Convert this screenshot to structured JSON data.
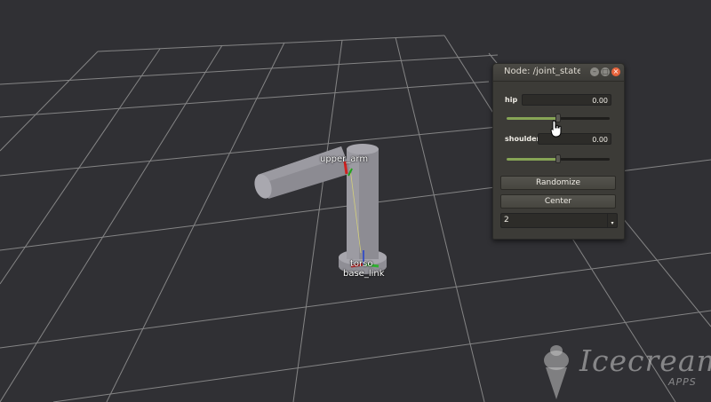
{
  "scene": {
    "background_color": "#303034",
    "grid_color": "#9a9a9a",
    "labels": {
      "upper_arm": "upper_arm",
      "torso": "torso",
      "base_link": "base_link"
    }
  },
  "jsp_window": {
    "title": "Node: /joint_state_publisher",
    "buttons": {
      "minimize": "–",
      "maximize": "□",
      "close": "×"
    },
    "joints": [
      {
        "name": "hip",
        "value": "0.00",
        "position": 0.5
      },
      {
        "name": "shoulder",
        "value": "0.00",
        "position": 0.5
      }
    ],
    "randomize_label": "Randomize",
    "center_label": "Center",
    "spin_value": "2",
    "spin_arrow": "▾",
    "slider_fill_color": "#87a556"
  },
  "watermark": {
    "brand": "Icecream",
    "sub": "APPS"
  }
}
